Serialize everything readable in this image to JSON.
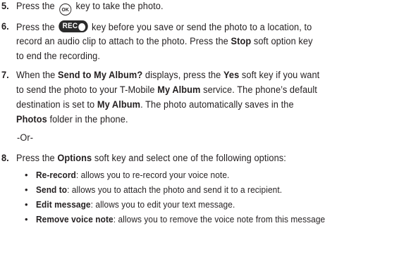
{
  "steps": [
    {
      "number": "5.",
      "text_a": "Press the ",
      "key": "OK",
      "text_b": " key to take the photo."
    },
    {
      "number": "6.",
      "l1_a": "Press the ",
      "key": "REC",
      "l1_b": " key before you save or send the photo to a location, to",
      "l2": "record an audio clip to attach to the photo. Press the ",
      "l2_bold": "Stop",
      "l2_end": " soft option key",
      "l3": "to end the recording."
    },
    {
      "number": "7.",
      "l1_a": "When the ",
      "l1_b1": "Send to My Album?",
      "l1_c": " displays, press the ",
      "l1_b2": "Yes",
      "l1_d": " soft key if you want",
      "l2_a": "to send the photo to your T-Mobile ",
      "l2_b": "My Album",
      "l2_c": " service. The phone’s default",
      "l3_a": "destination is set to ",
      "l3_b": "My Album",
      "l3_c": ". The photo automatically saves in the",
      "l4_b": "Photos",
      "l4_c": " folder in the phone."
    },
    {
      "number": "8.",
      "text_a": "Press the ",
      "text_b": "Options",
      "text_c": " soft key and select one of the following options:"
    }
  ],
  "or_text": "-Or-",
  "options": [
    {
      "bullet": "•",
      "term": "Re-record",
      "desc": ": allows you to re-record your voice note."
    },
    {
      "bullet": "•",
      "term": "Send to",
      "desc": ": allows you to attach the photo and send it to a recipient."
    },
    {
      "bullet": "•",
      "term": "Edit message",
      "desc": ": allows you to edit your text message."
    },
    {
      "bullet": "•",
      "term": "Remove voice note",
      "desc": ": allows you to remove the voice note from this message"
    }
  ]
}
